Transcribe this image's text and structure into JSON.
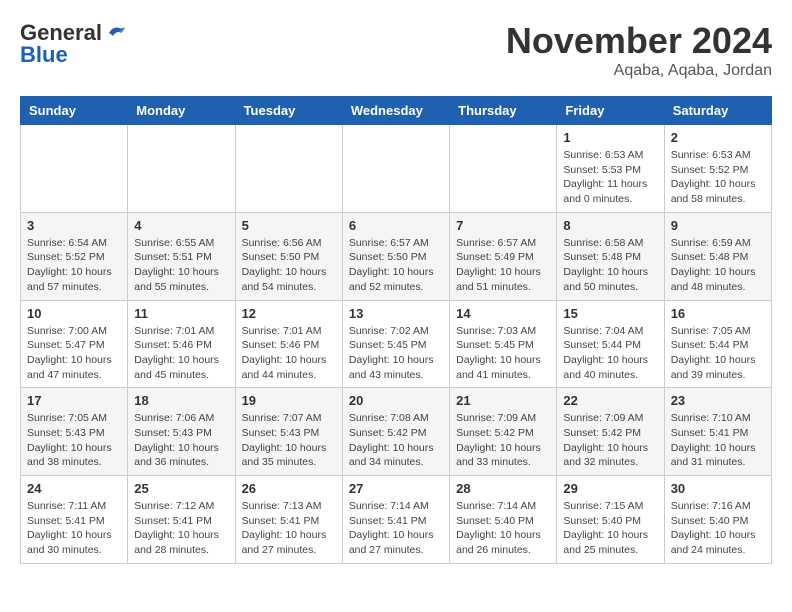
{
  "header": {
    "logo_line1": "General",
    "logo_line2": "Blue",
    "month": "November 2024",
    "location": "Aqaba, Aqaba, Jordan"
  },
  "weekdays": [
    "Sunday",
    "Monday",
    "Tuesday",
    "Wednesday",
    "Thursday",
    "Friday",
    "Saturday"
  ],
  "weeks": [
    [
      {
        "day": "",
        "info": ""
      },
      {
        "day": "",
        "info": ""
      },
      {
        "day": "",
        "info": ""
      },
      {
        "day": "",
        "info": ""
      },
      {
        "day": "",
        "info": ""
      },
      {
        "day": "1",
        "info": "Sunrise: 6:53 AM\nSunset: 5:53 PM\nDaylight: 11 hours and 0 minutes."
      },
      {
        "day": "2",
        "info": "Sunrise: 6:53 AM\nSunset: 5:52 PM\nDaylight: 10 hours and 58 minutes."
      }
    ],
    [
      {
        "day": "3",
        "info": "Sunrise: 6:54 AM\nSunset: 5:52 PM\nDaylight: 10 hours and 57 minutes."
      },
      {
        "day": "4",
        "info": "Sunrise: 6:55 AM\nSunset: 5:51 PM\nDaylight: 10 hours and 55 minutes."
      },
      {
        "day": "5",
        "info": "Sunrise: 6:56 AM\nSunset: 5:50 PM\nDaylight: 10 hours and 54 minutes."
      },
      {
        "day": "6",
        "info": "Sunrise: 6:57 AM\nSunset: 5:50 PM\nDaylight: 10 hours and 52 minutes."
      },
      {
        "day": "7",
        "info": "Sunrise: 6:57 AM\nSunset: 5:49 PM\nDaylight: 10 hours and 51 minutes."
      },
      {
        "day": "8",
        "info": "Sunrise: 6:58 AM\nSunset: 5:48 PM\nDaylight: 10 hours and 50 minutes."
      },
      {
        "day": "9",
        "info": "Sunrise: 6:59 AM\nSunset: 5:48 PM\nDaylight: 10 hours and 48 minutes."
      }
    ],
    [
      {
        "day": "10",
        "info": "Sunrise: 7:00 AM\nSunset: 5:47 PM\nDaylight: 10 hours and 47 minutes."
      },
      {
        "day": "11",
        "info": "Sunrise: 7:01 AM\nSunset: 5:46 PM\nDaylight: 10 hours and 45 minutes."
      },
      {
        "day": "12",
        "info": "Sunrise: 7:01 AM\nSunset: 5:46 PM\nDaylight: 10 hours and 44 minutes."
      },
      {
        "day": "13",
        "info": "Sunrise: 7:02 AM\nSunset: 5:45 PM\nDaylight: 10 hours and 43 minutes."
      },
      {
        "day": "14",
        "info": "Sunrise: 7:03 AM\nSunset: 5:45 PM\nDaylight: 10 hours and 41 minutes."
      },
      {
        "day": "15",
        "info": "Sunrise: 7:04 AM\nSunset: 5:44 PM\nDaylight: 10 hours and 40 minutes."
      },
      {
        "day": "16",
        "info": "Sunrise: 7:05 AM\nSunset: 5:44 PM\nDaylight: 10 hours and 39 minutes."
      }
    ],
    [
      {
        "day": "17",
        "info": "Sunrise: 7:05 AM\nSunset: 5:43 PM\nDaylight: 10 hours and 38 minutes."
      },
      {
        "day": "18",
        "info": "Sunrise: 7:06 AM\nSunset: 5:43 PM\nDaylight: 10 hours and 36 minutes."
      },
      {
        "day": "19",
        "info": "Sunrise: 7:07 AM\nSunset: 5:43 PM\nDaylight: 10 hours and 35 minutes."
      },
      {
        "day": "20",
        "info": "Sunrise: 7:08 AM\nSunset: 5:42 PM\nDaylight: 10 hours and 34 minutes."
      },
      {
        "day": "21",
        "info": "Sunrise: 7:09 AM\nSunset: 5:42 PM\nDaylight: 10 hours and 33 minutes."
      },
      {
        "day": "22",
        "info": "Sunrise: 7:09 AM\nSunset: 5:42 PM\nDaylight: 10 hours and 32 minutes."
      },
      {
        "day": "23",
        "info": "Sunrise: 7:10 AM\nSunset: 5:41 PM\nDaylight: 10 hours and 31 minutes."
      }
    ],
    [
      {
        "day": "24",
        "info": "Sunrise: 7:11 AM\nSunset: 5:41 PM\nDaylight: 10 hours and 30 minutes."
      },
      {
        "day": "25",
        "info": "Sunrise: 7:12 AM\nSunset: 5:41 PM\nDaylight: 10 hours and 28 minutes."
      },
      {
        "day": "26",
        "info": "Sunrise: 7:13 AM\nSunset: 5:41 PM\nDaylight: 10 hours and 27 minutes."
      },
      {
        "day": "27",
        "info": "Sunrise: 7:14 AM\nSunset: 5:41 PM\nDaylight: 10 hours and 27 minutes."
      },
      {
        "day": "28",
        "info": "Sunrise: 7:14 AM\nSunset: 5:40 PM\nDaylight: 10 hours and 26 minutes."
      },
      {
        "day": "29",
        "info": "Sunrise: 7:15 AM\nSunset: 5:40 PM\nDaylight: 10 hours and 25 minutes."
      },
      {
        "day": "30",
        "info": "Sunrise: 7:16 AM\nSunset: 5:40 PM\nDaylight: 10 hours and 24 minutes."
      }
    ]
  ]
}
